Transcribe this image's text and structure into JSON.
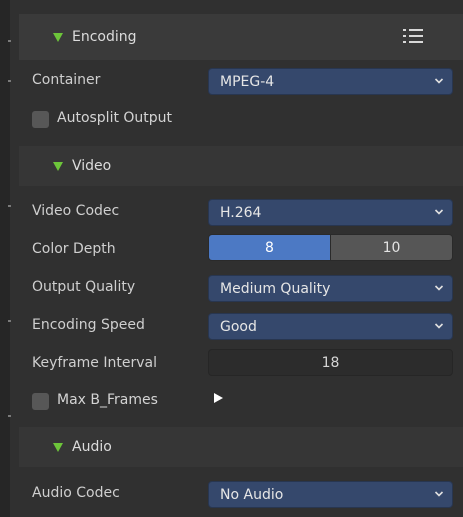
{
  "encoding": {
    "title": "Encoding",
    "container_label": "Container",
    "container_value": "MPEG-4",
    "autosplit_label": "Autosplit Output",
    "autosplit_checked": false
  },
  "video": {
    "title": "Video",
    "codec_label": "Video Codec",
    "codec_value": "H.264",
    "color_depth_label": "Color Depth",
    "color_depth_options": [
      "8",
      "10"
    ],
    "color_depth_selected": "8",
    "quality_label": "Output Quality",
    "quality_value": "Medium Quality",
    "speed_label": "Encoding Speed",
    "speed_value": "Good",
    "keyframe_label": "Keyframe Interval",
    "keyframe_value": "18",
    "max_bframes_label": "Max B_Frames",
    "max_bframes_checked": false
  },
  "audio": {
    "title": "Audio",
    "codec_label": "Audio Codec",
    "codec_value": "No Audio"
  },
  "colors": {
    "panel_bg": "#303030",
    "header_bg": "#3a3a3a",
    "dropdown_bg": "#35486c",
    "selected_segment": "#4c79c4",
    "triangle_accent": "#6dc53a"
  }
}
